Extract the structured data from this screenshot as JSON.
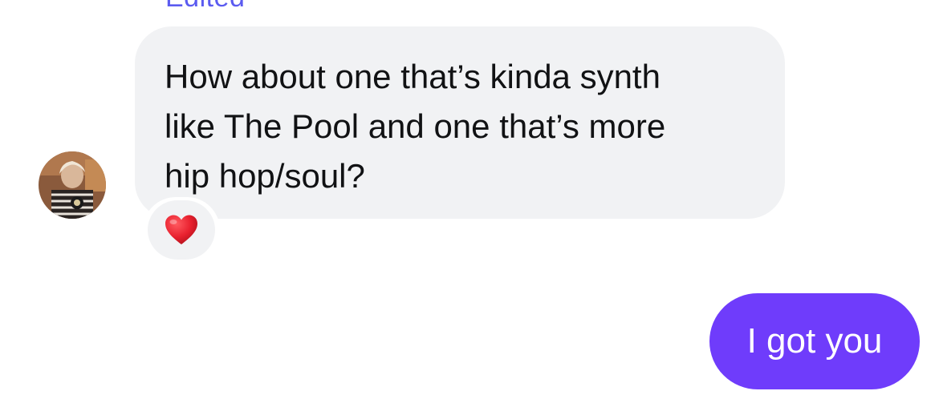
{
  "conversation": {
    "edited_label": "Edited",
    "incoming_message": {
      "text": "How about one that’s kinda synth\nlike The Pool and one that’s more\nhip hop/soul?",
      "reaction_icon": "heart-emoji-icon"
    },
    "outgoing_message": {
      "text": "I got you"
    }
  },
  "colors": {
    "incoming_bubble": "#f1f2f4",
    "outgoing_bubble": "#6f3cfb",
    "edited_label": "#5b5bf0",
    "reaction_heart": "#e8202e"
  }
}
